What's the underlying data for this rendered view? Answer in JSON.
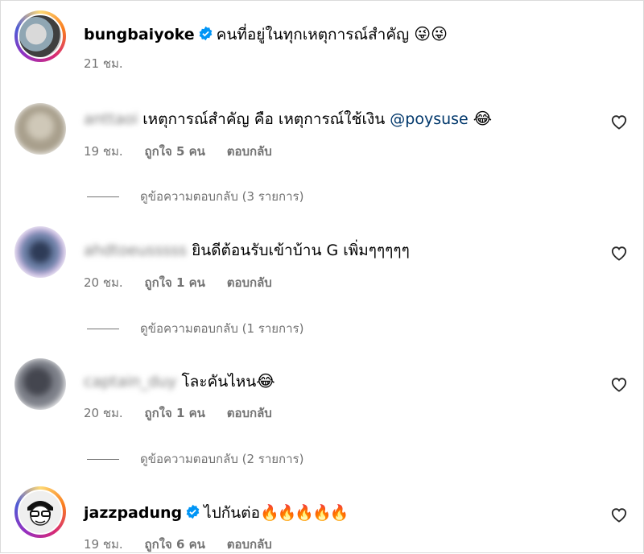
{
  "colors": {
    "link": "#00376b",
    "muted": "#737373",
    "verified": "#0095f6",
    "heart_stroke": "#262626"
  },
  "post": {
    "username": "bungbaiyoke",
    "caption": "คนที่อยู่ในทุกเหตุการณ์สำคัญ",
    "caption_emoji": "😜😜",
    "time": "21 ชม."
  },
  "comments": [
    {
      "username": "anttaoi",
      "text": "เหตุการณ์สำคัญ คือ เหตุการณ์ใช้เงิน",
      "mention": "@poysuse",
      "emoji": "😂",
      "time": "19 ชม.",
      "likes": "ถูกใจ 5 คน",
      "reply": "ตอบกลับ",
      "view_replies": "ดูข้อความตอบกลับ (3 รายการ)"
    },
    {
      "username": "ahdtoeusssss",
      "text": "ยินดีต้อนรับเข้าบ้าน G เพิ่มๆๆๆๆๆ",
      "time": "20 ชม.",
      "likes": "ถูกใจ 1 คน",
      "reply": "ตอบกลับ",
      "view_replies": "ดูข้อความตอบกลับ (1 รายการ)"
    },
    {
      "username": "captain_duy",
      "text": "โละคันไหน",
      "emoji": "😂",
      "time": "20 ชม.",
      "likes": "ถูกใจ 1 คน",
      "reply": "ตอบกลับ",
      "view_replies": "ดูข้อความตอบกลับ (2 รายการ)"
    },
    {
      "username": "jazzpadung",
      "text": "ไปกันต่อ",
      "emoji": "🔥🔥🔥🔥🔥",
      "time": "19 ชม.",
      "likes": "ถูกใจ 6 คน",
      "reply": "ตอบกลับ"
    }
  ],
  "icons": {
    "verified": "verified-badge-icon",
    "like": "heart-outline-icon"
  }
}
